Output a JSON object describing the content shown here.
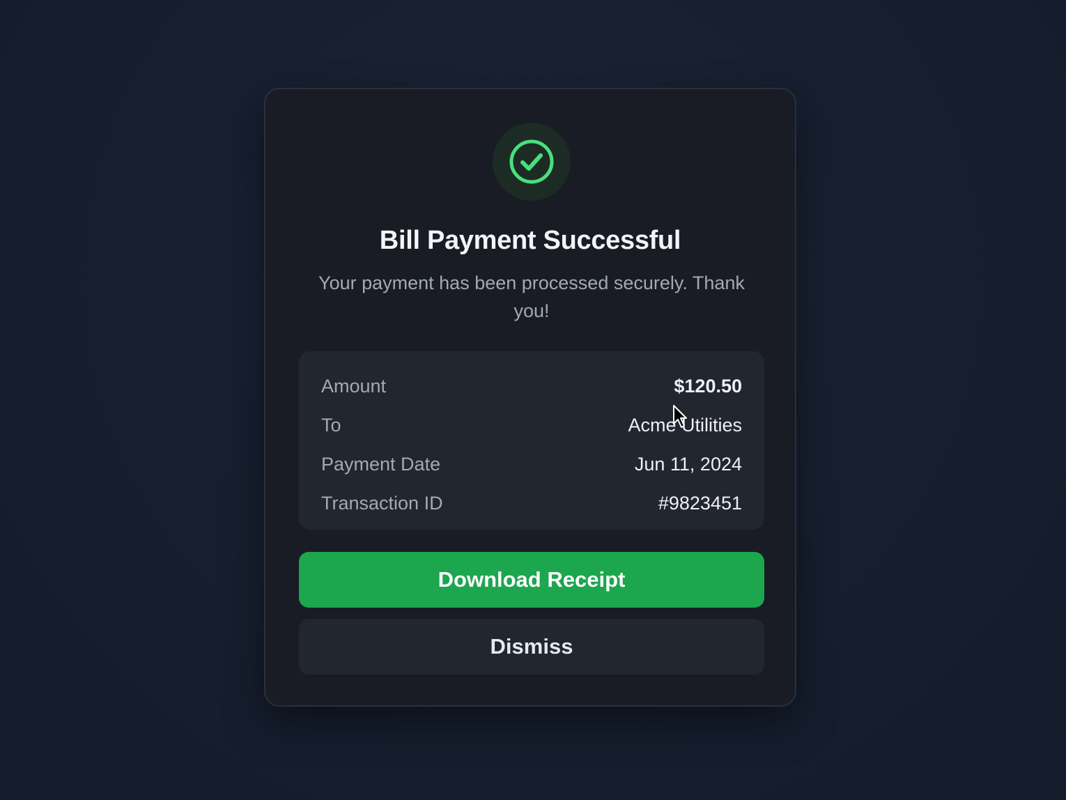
{
  "dialog": {
    "title": "Bill Payment Successful",
    "subtitle": "Your payment has been processed securely. Thank you!",
    "status_icon": "check-circle-icon",
    "accent_color": "#4ade80"
  },
  "details": [
    {
      "label": "Amount",
      "value": "$120.50"
    },
    {
      "label": "To",
      "value": "Acme Utilities"
    },
    {
      "label": "Payment Date",
      "value": "Jun 11, 2024"
    },
    {
      "label": "Transaction ID",
      "value": "#9823451"
    }
  ],
  "actions": {
    "primary_label": "Download Receipt",
    "primary_color": "#1ca64e",
    "secondary_label": "Dismiss"
  }
}
